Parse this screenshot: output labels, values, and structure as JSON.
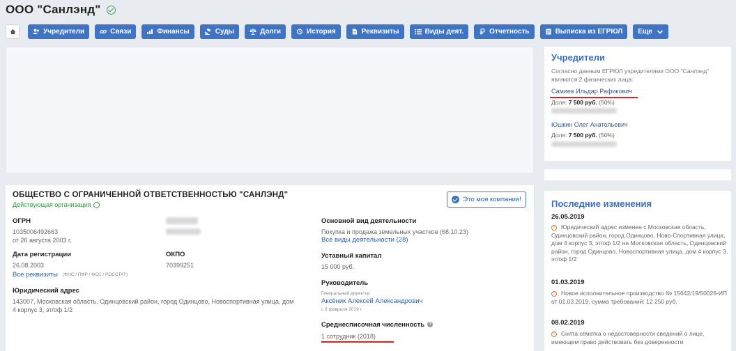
{
  "page": {
    "title": "ООО \"Санлэнд\""
  },
  "nav": {
    "items": [
      {
        "label": "Учредители",
        "icon": "users-icon"
      },
      {
        "label": "Связи",
        "icon": "link-icon"
      },
      {
        "label": "Финансы",
        "icon": "chart-icon"
      },
      {
        "label": "Суды",
        "icon": "gavel-icon"
      },
      {
        "label": "Долги",
        "icon": "scales-icon"
      },
      {
        "label": "История",
        "icon": "history-icon"
      },
      {
        "label": "Реквизиты",
        "icon": "document-icon"
      },
      {
        "label": "Виды деят.",
        "icon": "list-icon"
      },
      {
        "label": "Отчетность",
        "icon": "ruble-icon"
      },
      {
        "label": "Выписка из ЕГРЮЛ",
        "icon": "extract-icon"
      },
      {
        "label": "Еще",
        "icon": "chevron-down-icon"
      }
    ]
  },
  "company": {
    "full_name": "ОБЩЕСТВО С ОГРАНИЧЕННОЙ ОТВЕТСТВЕННОСТЬЮ \"САНЛЭНД\"",
    "status": "Действующая организация",
    "mine_button": "Это моя компания!",
    "ogrn_label": "ОГРН",
    "ogrn_value": "1035006492663",
    "ogrn_date": "от 26 августа 2003 г.",
    "reg_date_label": "Дата регистрации",
    "reg_date_value": "26.08.2003",
    "okpo_label": "ОКПО",
    "okpo_value": "70399251",
    "all_requisites_link": "Все реквизиты",
    "requisites_note": "(ФНС / ПФР / ФСС / РОССТАТ)",
    "address_label": "Юридический адрес",
    "address_line1": "143007, Московская область, Одинцовский район, город Одинцово, Новоспортивная улица, дом",
    "address_line2": "4 корпус 3, эт/оф 1/2",
    "activity_label": "Основной вид деятельности",
    "activity_value": "Покупка и продажа земельных участков (68.10.23)",
    "activity_link": "Все виды деятельности (28)",
    "capital_label": "Уставный капитал",
    "capital_value": "15 000 руб.",
    "director_label": "Руководитель",
    "director_role": "Генеральный директор",
    "director_name": "Аксёник Алексей Александрович",
    "director_since": "с 8 февраля 2019 г.",
    "staff_label": "Среднесписочная численность",
    "staff_value": "1 сотрудник (2018)"
  },
  "founders": {
    "title": "Учредители",
    "intro": "Согласно данным ЕГРЮЛ учредителями ООО \"Санлэнд\" являются 2 физических лица:",
    "share_label": "Доля:",
    "people": [
      {
        "name": "Самиев Ильдар Рафикович",
        "share": "7 500 руб.",
        "percent": "(50%)"
      },
      {
        "name": "Юшкин Олег Анатольевич",
        "share": "7 500 руб.",
        "percent": "(50%)"
      }
    ]
  },
  "changes": {
    "title": "Последние изменения",
    "items": [
      {
        "date": "26.05.2019",
        "text": "Юридический адрес изменен с Московская область, Одинцовский район, город Одинцово, Ново-Спортивная улица, дом 4 корпус 3, эт/оф 1/2 на Московская область, Одинцовский район, город Одинцово, Новоспортивная улица, дом 4 корпус 3, эт/оф 1/2"
      },
      {
        "date": "01.03.2019",
        "text": "Новое исполнительное производство № 15642/19/50026-ИП от 01.03.2019, сумма требований: 12 250 руб."
      },
      {
        "date": "08.02.2019",
        "text": "Снята отметка о недостоверности сведений о лице, имеющем право действовать без доверенности"
      }
    ]
  },
  "colors": {
    "accent": "#3f73c3",
    "status_green": "#3a9a47",
    "highlight": "#e02020"
  }
}
